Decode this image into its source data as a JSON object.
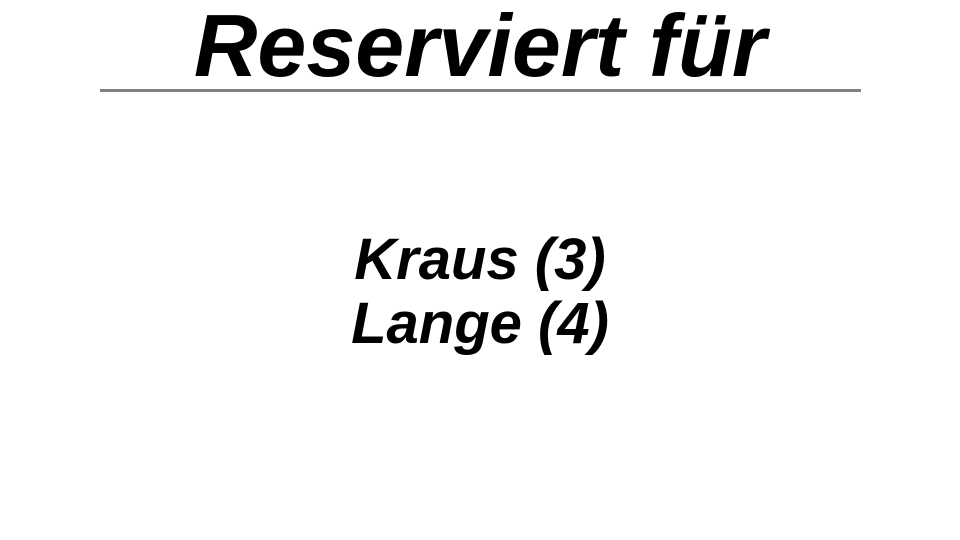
{
  "slide": {
    "title": "Reserviert für",
    "reservations": [
      "Kraus (3)",
      "Lange (4)"
    ]
  },
  "colors": {
    "background": "#ffffff",
    "text": "#000000",
    "rule": "#808080"
  }
}
